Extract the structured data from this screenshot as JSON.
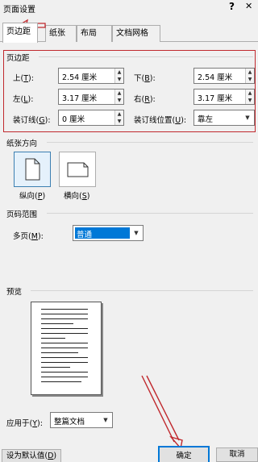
{
  "window": {
    "title": "页面设置",
    "help": "?",
    "close": "✕"
  },
  "tabs": [
    {
      "label": "页边距"
    },
    {
      "label": "纸张"
    },
    {
      "label": "布局"
    },
    {
      "label": "文档网格"
    }
  ],
  "margins": {
    "group_label": "页边距",
    "top": {
      "label": "上",
      "key": "T",
      "value": "2.54 厘米"
    },
    "bottom": {
      "label": "下",
      "key": "B",
      "value": "2.54 厘米"
    },
    "left": {
      "label": "左",
      "key": "L",
      "value": "3.17 厘米"
    },
    "right": {
      "label": "右",
      "key": "R",
      "value": "3.17 厘米"
    },
    "gutter": {
      "label": "装订线",
      "key": "G",
      "value": "0 厘米"
    },
    "gutter_pos": {
      "label": "装订线位置",
      "key": "U",
      "value": "靠左"
    }
  },
  "orientation": {
    "group_label": "纸张方向",
    "portrait": {
      "label": "纵向",
      "key": "P"
    },
    "landscape": {
      "label": "横向",
      "key": "S"
    }
  },
  "pages": {
    "group_label": "页码范围",
    "multi_label": "多页",
    "multi_key": "M",
    "multi_value": "普通"
  },
  "preview": {
    "group_label": "预览",
    "apply_label": "应用于",
    "apply_key": "Y",
    "apply_value": "整篇文档"
  },
  "footer": {
    "default_label": "设为默认值",
    "default_key": "D",
    "ok_label": "确定",
    "cancel_label": "取消"
  },
  "colors": {
    "annotation": "#c0282d",
    "selected": "#3c7fb1",
    "highlight": "#0078d7"
  }
}
